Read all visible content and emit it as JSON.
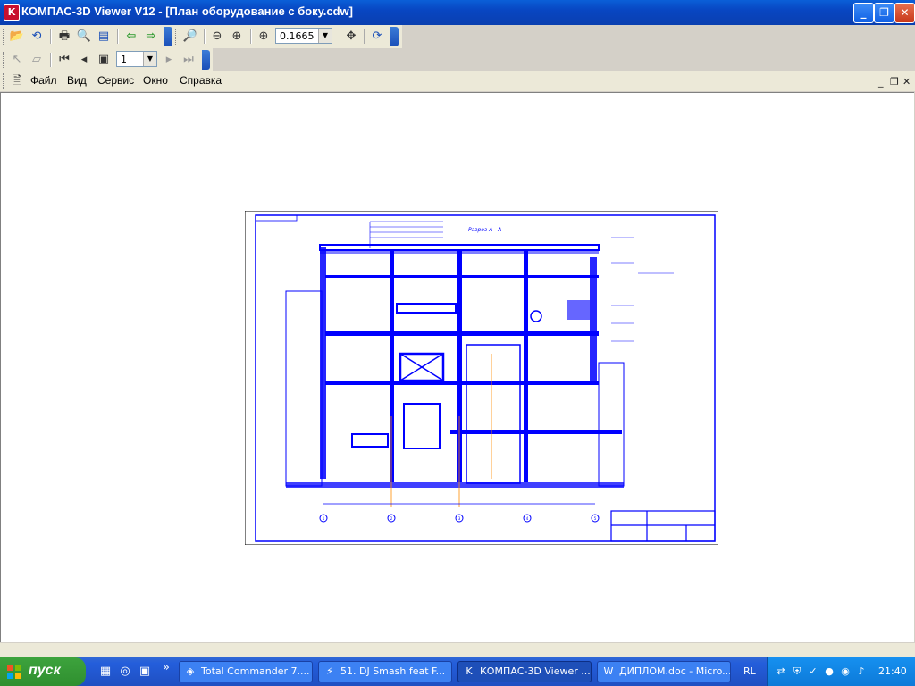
{
  "window": {
    "title": "КОМПАС-3D Viewer V12 - [План оборудование с боку.cdw]",
    "app_icon": "kompas-logo-icon",
    "buttons": {
      "minimize": "_",
      "maximize": "❐",
      "close": "✕"
    }
  },
  "toolbar1": {
    "zoom_value": "0.1665"
  },
  "toolbar2": {
    "page_value": "1"
  },
  "menu": {
    "items": [
      "Файл",
      "Вид",
      "Сервис",
      "Окно",
      "Справка"
    ],
    "mdi_buttons": [
      "_",
      "❐",
      "✕"
    ]
  },
  "drawing": {
    "section_title": "Разрез А - А",
    "axis_labels": [
      "1",
      "2",
      "3",
      "4",
      "5"
    ],
    "colors": {
      "line": "#0000ff",
      "axis": "#ff8c00",
      "paper": "#ffffff"
    }
  },
  "taskbar": {
    "start_label": "пуск",
    "quicklaunch_overflow": "»",
    "tasks": [
      {
        "label": "Total Commander 7....",
        "icon": "total-commander-icon"
      },
      {
        "label": "51. DJ Smash feat F...",
        "icon": "winamp-icon"
      },
      {
        "label": "КОМПАС-3D Viewer ...",
        "icon": "kompas-icon"
      },
      {
        "label": "ДИПЛОМ.doc - Micro...",
        "icon": "word-icon"
      }
    ],
    "language": "RL",
    "clock": "21:40"
  }
}
